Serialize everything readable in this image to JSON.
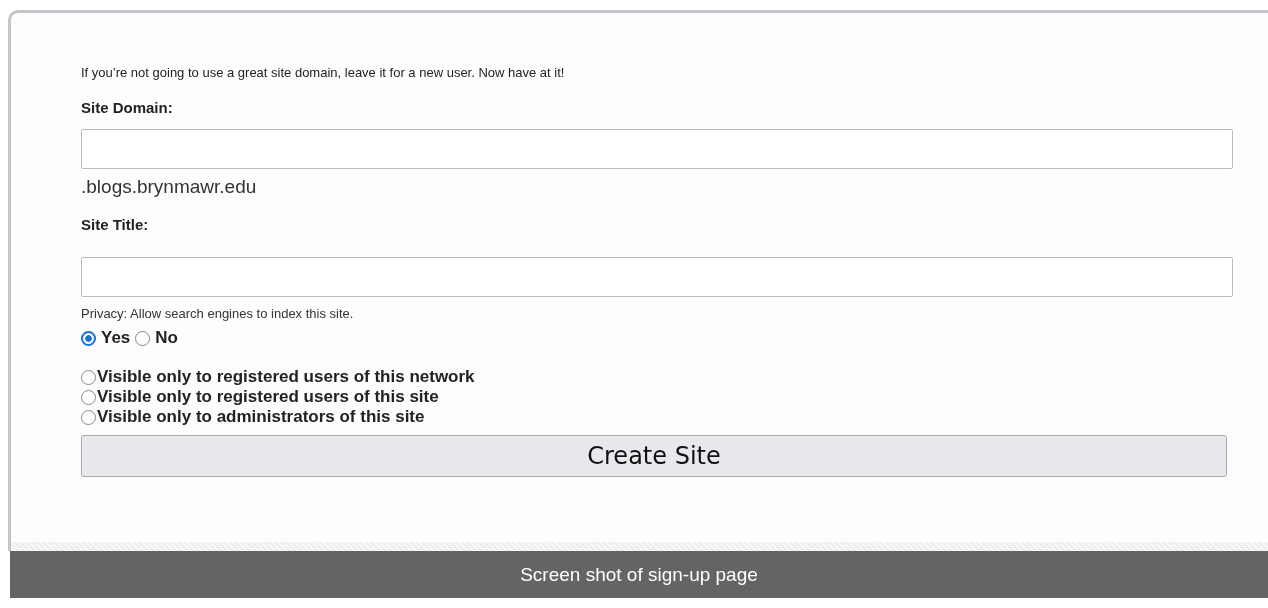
{
  "intro": "If you’re not going to use a great site domain, leave it for a new user. Now have at it!",
  "domain": {
    "label": "Site Domain:",
    "suffix": ".blogs.brynmawr.edu"
  },
  "title_field": {
    "label": "Site Title:"
  },
  "privacy": {
    "label": "Privacy: Allow search engines to index this site.",
    "options": [
      {
        "label": "Yes",
        "selected": true
      },
      {
        "label": "No",
        "selected": false
      }
    ]
  },
  "visibility": [
    {
      "label": "Visible only to registered users of this network",
      "selected": false
    },
    {
      "label": "Visible only to registered users of this site",
      "selected": false
    },
    {
      "label": "Visible only to administrators of this site",
      "selected": false
    }
  ],
  "submit": "Create Site",
  "caption": "Screen shot of sign-up page"
}
